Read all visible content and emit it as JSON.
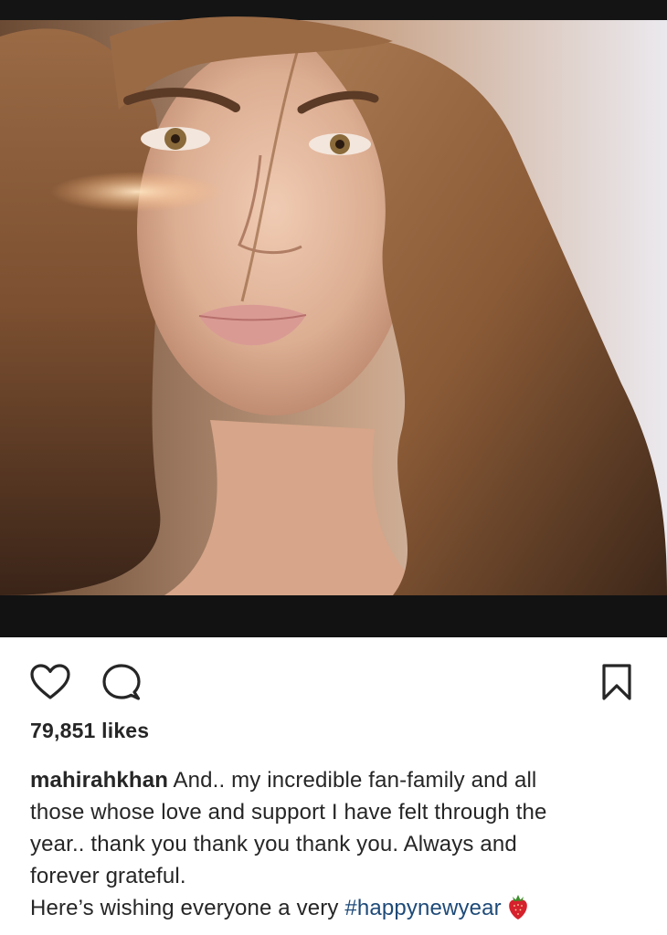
{
  "post": {
    "image": {
      "icon": "portrait-photo",
      "colors": {
        "frame": "#141414",
        "hair": "#8a5a36",
        "skin": "#e2b69c",
        "background": "#e8e6ea"
      }
    },
    "actions": {
      "like_icon": "heart-outline-icon",
      "comment_icon": "comment-bubble-icon",
      "save_icon": "bookmark-outline-icon"
    },
    "likes": "79,851 likes",
    "caption": {
      "username": "mahirahkhan",
      "line1": " And.. my incredible fan-family and all",
      "line2": "those whose love and support I have felt through the",
      "line3": "year.. thank you thank you thank you. Always and",
      "line4": "forever grateful.",
      "line5_prefix": "Here’s wishing everyone a very ",
      "hashtag": "#happynewyear",
      "emoji_icon": "strawberry-icon"
    },
    "colors": {
      "text": "#262626",
      "hashtag": "#1e4a78",
      "background": "#ffffff"
    }
  }
}
